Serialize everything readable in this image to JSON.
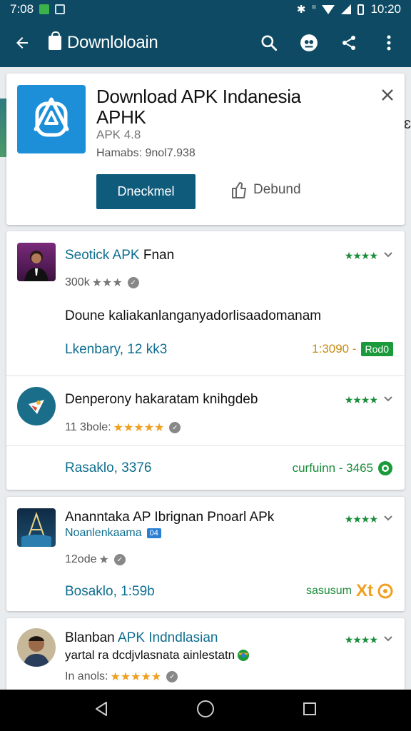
{
  "status_bar": {
    "time_left": "7:08",
    "time_right": "10:20"
  },
  "app_bar": {
    "title": "Downloloain"
  },
  "header": {
    "title": "Download APK Indanesia APHK",
    "version": "APK 4.8",
    "meta": "Hamabs: 9nol7.938",
    "primary_button": "Dneckmel",
    "secondary_button": "Debund"
  },
  "items": [
    {
      "title": "Seotick APK",
      "title_suffix": "Fnan",
      "rating_text": "300k",
      "body": "Doune kaliakanlanganyadorlisaadomanam",
      "link": "Lkenbary, 12 kk3",
      "right_value": "1:3090 -",
      "right_tag": "Rod0"
    },
    {
      "title": "Denperony hakaratam knihgdeb",
      "rating_text": "11 3bole:",
      "link": "Rasaklo, 3376",
      "right_value": "curfuinn - 3465"
    },
    {
      "title": "Ananntaka AP Ibrignan Pnoarl APk",
      "subtitle": "Noanlenkaama",
      "subtitle_tag": "04",
      "rating_text": "12ode",
      "link": "Bosaklo, 1:59b",
      "right_value": "sasusum",
      "right_badge": "Xt"
    },
    {
      "title": "Blanban",
      "title_blue": "APK Indndlasian",
      "subtitle": "yartal ra dcdjvlasnata ainlestatn",
      "rating_text": "In anols:"
    }
  ],
  "colors": {
    "bar": "#0e4a63",
    "accent": "#0e6e8f",
    "button": "#0e5b7c",
    "green": "#1a8c3a",
    "star": "#f0a020"
  }
}
